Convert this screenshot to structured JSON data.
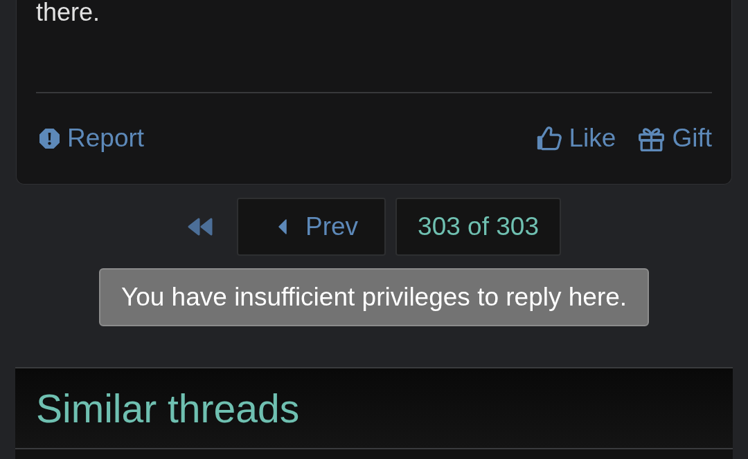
{
  "post": {
    "body_text": "there.",
    "actions_left": [
      {
        "kind": "report",
        "label": "Report"
      }
    ],
    "actions_right": [
      {
        "kind": "like",
        "label": "Like"
      },
      {
        "kind": "gift",
        "label": "Gift"
      }
    ]
  },
  "pagination": {
    "prev_label": "Prev",
    "page_status": "303 of 303"
  },
  "notice": "You have insufficient privileges to reply here.",
  "similar_threads": {
    "title": "Similar threads"
  }
}
